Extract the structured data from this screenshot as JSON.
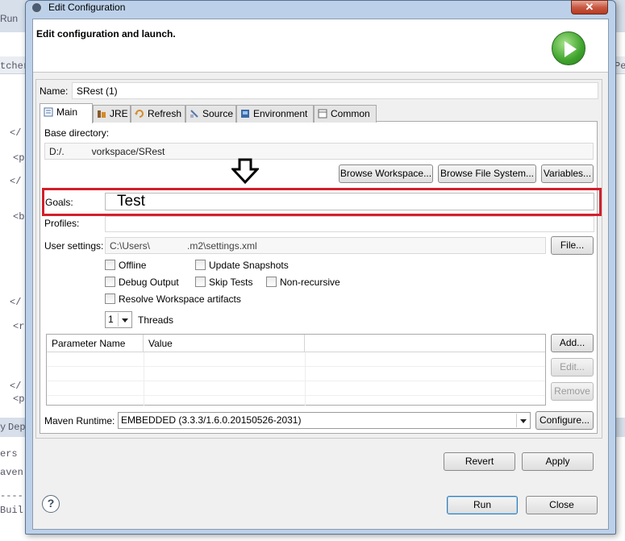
{
  "background": {
    "run_menu": "Run",
    "left_frag_1": "tcher-",
    "right_frag_1": "Pe",
    "tab_frag_1": "y",
    "tab_frag_2": "Dep",
    "left_frag_2": "ers",
    "left_frag_3": "aven Bu",
    "left_frag_4": "----",
    "left_frag_5": "Buil",
    "code_lines": [
      "</",
      "<p",
      "</",
      "<b",
      "</",
      "<r",
      "</",
      "<p"
    ]
  },
  "window": {
    "title": "Edit Configuration",
    "close_glyph": "✕"
  },
  "header": {
    "title": "Edit configuration and launch."
  },
  "name": {
    "label": "Name:",
    "value": "SRest (1)"
  },
  "tabs": [
    {
      "label": "Main",
      "icon": "main-tab-icon"
    },
    {
      "label": "JRE",
      "icon": "jre-icon"
    },
    {
      "label": "Refresh",
      "icon": "refresh-icon"
    },
    {
      "label": "Source",
      "icon": "source-icon"
    },
    {
      "label": "Environment",
      "icon": "environment-icon"
    },
    {
      "label": "Common",
      "icon": "common-icon"
    }
  ],
  "main": {
    "base_dir_label": "Base directory:",
    "base_dir_value_prefix": "D:/.",
    "base_dir_value_suffix": "vorkspace/SRest",
    "browse_workspace": "Browse Workspace...",
    "browse_file_system": "Browse File System...",
    "variables": "Variables...",
    "goals_label": "Goals:",
    "goals_value": "Test",
    "profiles_label": "Profiles:",
    "profiles_value": "",
    "user_settings_label": "User settings:",
    "user_settings_prefix": "C:\\Users\\",
    "user_settings_suffix": ".m2\\settings.xml",
    "file_button": "File...",
    "checkboxes": {
      "offline": "Offline",
      "update_snapshots": "Update Snapshots",
      "debug_output": "Debug Output",
      "skip_tests": "Skip Tests",
      "non_recursive": "Non-recursive",
      "resolve_workspace": "Resolve Workspace artifacts"
    },
    "threads_value": "1",
    "threads_label": "Threads",
    "params_columns": [
      "Parameter Name",
      "Value"
    ],
    "add_button": "Add...",
    "edit_button": "Edit...",
    "remove_button": "Remove",
    "maven_runtime_label": "Maven Runtime:",
    "maven_runtime_value": "EMBEDDED (3.3.3/1.6.0.20150526-2031)",
    "configure_button": "Configure..."
  },
  "buttons": {
    "revert": "Revert",
    "apply": "Apply",
    "run": "Run",
    "close": "Close",
    "help": "?"
  },
  "colors": {
    "highlight": "#d21f2b",
    "run_icon_green": "#3ea32c"
  }
}
